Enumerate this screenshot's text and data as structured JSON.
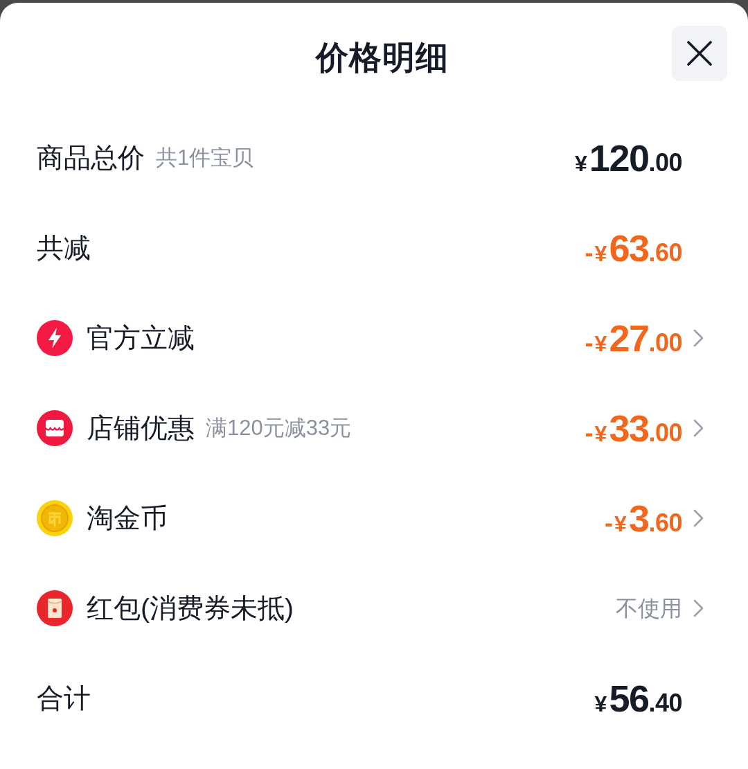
{
  "title": "价格明细",
  "rows": [
    {
      "kind": "subtotal",
      "label": "商品总价",
      "note": "共1件宝贝",
      "deduction": false,
      "opens": false,
      "amount": {
        "currency": "¥",
        "integer": "120",
        "decimals": ".00"
      }
    },
    {
      "kind": "discount",
      "label": "共减",
      "deduction": true,
      "opens": false,
      "amount": {
        "sign": "-",
        "currency": "¥",
        "integer": "63",
        "decimals": ".60"
      }
    },
    {
      "kind": "official",
      "label": "官方立减",
      "deduction": true,
      "opens": true,
      "amount": {
        "sign": "-",
        "currency": "¥",
        "integer": "27",
        "decimals": ".00"
      }
    },
    {
      "kind": "store",
      "label": "店铺优惠",
      "note": "满120元减33元",
      "deduction": true,
      "opens": true,
      "amount": {
        "sign": "-",
        "currency": "¥",
        "integer": "33",
        "decimals": ".00"
      }
    },
    {
      "kind": "coins",
      "label": "淘金币",
      "deduction": true,
      "opens": true,
      "amount": {
        "sign": "-",
        "currency": "¥",
        "integer": "3",
        "decimals": ".60"
      }
    },
    {
      "kind": "packet",
      "label": "红包(消费券未抵)",
      "deduction": false,
      "opens": true,
      "value": "不使用"
    },
    {
      "kind": "total",
      "label": "合计",
      "deduction": false,
      "opens": false,
      "amount": {
        "currency": "¥",
        "integer": "56",
        "decimals": ".40"
      }
    }
  ]
}
